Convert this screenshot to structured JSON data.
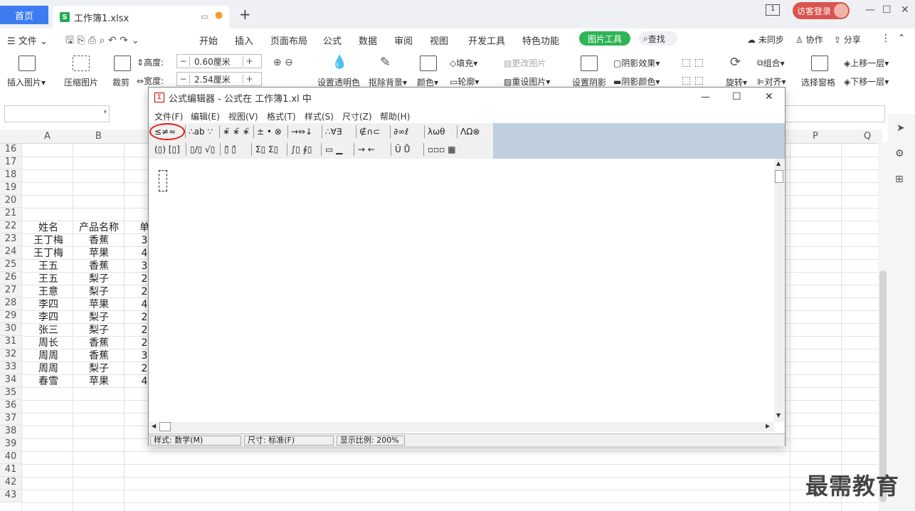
{
  "tabs": {
    "home": "首页",
    "file": "工作簿1.xlsx",
    "new_tab": "+"
  },
  "account": {
    "login": "访客登录",
    "page_indicator": "1"
  },
  "window_controls": {
    "min": "—",
    "max": "☐",
    "close": "✕"
  },
  "menubar": {
    "file": "文件",
    "items": [
      "开始",
      "插入",
      "页面布局",
      "公式",
      "数据",
      "审阅",
      "视图",
      "开发工具",
      "特色功能"
    ],
    "picture_tools": "图片工具",
    "search": "查找",
    "unsync": "未同步",
    "collab": "协作",
    "share": "分享"
  },
  "ribbon": {
    "insert_picture": "插入图片",
    "compress": "压缩图片",
    "crop": "裁剪",
    "height_label": "高度:",
    "height_value": "0.60厘米",
    "width_label": "宽度:",
    "width_value": "2.54厘米",
    "transparency": "设置透明色",
    "remove_bg": "抠除背景",
    "color": "颜色",
    "fill": "填充",
    "outline": "轮廓",
    "change_pic": "更改图片",
    "reset_pic": "重设图片",
    "set_shadow": "设置阴影",
    "shadow_effect": "阴影效果",
    "shadow_color": "阴影颜色",
    "rotate": "旋转",
    "group": "组合",
    "align": "对齐",
    "select_pane": "选择窗格",
    "bring_forward": "上移一层",
    "send_backward": "下移一层"
  },
  "grid": {
    "col_headers": [
      "A",
      "B",
      "P",
      "Q"
    ],
    "row_numbers": [
      "16",
      "17",
      "18",
      "19",
      "20",
      "21",
      "22",
      "23",
      "24",
      "25",
      "26",
      "27",
      "28",
      "29",
      "30",
      "31",
      "32",
      "33",
      "34",
      "35",
      "36",
      "37",
      "38",
      "39",
      "40",
      "41",
      "42",
      "43"
    ],
    "header_row": {
      "name": "姓名",
      "product": "产品名称",
      "c": "单"
    },
    "rows": [
      {
        "name": "王丁梅",
        "product": "香蕉",
        "c": "3"
      },
      {
        "name": "王丁梅",
        "product": "苹果",
        "c": "4"
      },
      {
        "name": "王五",
        "product": "香蕉",
        "c": "3"
      },
      {
        "name": "王五",
        "product": "梨子",
        "c": "2"
      },
      {
        "name": "王意",
        "product": "梨子",
        "c": "2"
      },
      {
        "name": "李四",
        "product": "苹果",
        "c": "4"
      },
      {
        "name": "李四",
        "product": "梨子",
        "c": "2"
      },
      {
        "name": "张三",
        "product": "梨子",
        "c": "2"
      },
      {
        "name": "周长",
        "product": "香蕉",
        "c": "2"
      },
      {
        "name": "周周",
        "product": "香蕉",
        "c": "3"
      },
      {
        "name": "周周",
        "product": "梨子",
        "c": "2"
      },
      {
        "name": "春雪",
        "product": "苹果",
        "c": "4"
      }
    ]
  },
  "dialog": {
    "title": "公式编辑器 - 公式在 工作簿1.xl 中",
    "menu": [
      "文件(F)",
      "编辑(E)",
      "视图(V)",
      "格式(T)",
      "样式(S)",
      "尺寸(Z)",
      "帮助(H)"
    ],
    "toolbar1": [
      "≤≠≈",
      "∴ab ∵",
      "∗̈ ∗̈ ∗̈",
      "± • ⊗",
      "→⇔↓",
      "∴∀∃",
      "∉∩⊂",
      "∂∞ℓ",
      "λωθ",
      "ΛΩ⊗"
    ],
    "toolbar2": [
      "(▯) [▯]",
      "▯/▯ √▯",
      "▯̈ ▯̄",
      "Σ▯ Σ▯",
      "∫▯ ∮▯",
      "▭ ▁",
      "→ ←",
      "Ū Ů",
      "▫▫▫ ▦"
    ],
    "status": {
      "style": "样式: 数学(M)",
      "size": "尺寸: 标准(F)",
      "zoom": "显示比例: 200%"
    }
  },
  "watermark": "最需教育",
  "colors": {
    "accent": "#3d7cf0",
    "picture_tools": "#2fb456",
    "login": "#d9534f",
    "highlight": "#e02020"
  }
}
